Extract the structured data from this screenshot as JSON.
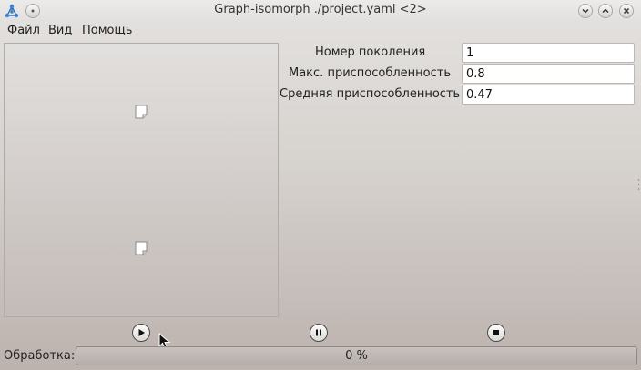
{
  "window": {
    "title": "Graph-isomorph ./project.yaml <2>"
  },
  "menu": {
    "items": [
      {
        "label": "Файл"
      },
      {
        "label": "Вид"
      },
      {
        "label": "Помощь"
      }
    ]
  },
  "fields": [
    {
      "label": "Номер поколения",
      "value": "1"
    },
    {
      "label": "Макс. приспособленность",
      "value": "0.8"
    },
    {
      "label": "Средняя приспособленность",
      "value": "0.47"
    }
  ],
  "controls": {
    "play_icon": "play-icon",
    "pause_icon": "pause-icon",
    "stop_icon": "stop-icon"
  },
  "progress": {
    "label": "Обработка:",
    "value": 0,
    "text": "0 %"
  },
  "colors": {
    "progress_fill": "#6a9ed0"
  }
}
